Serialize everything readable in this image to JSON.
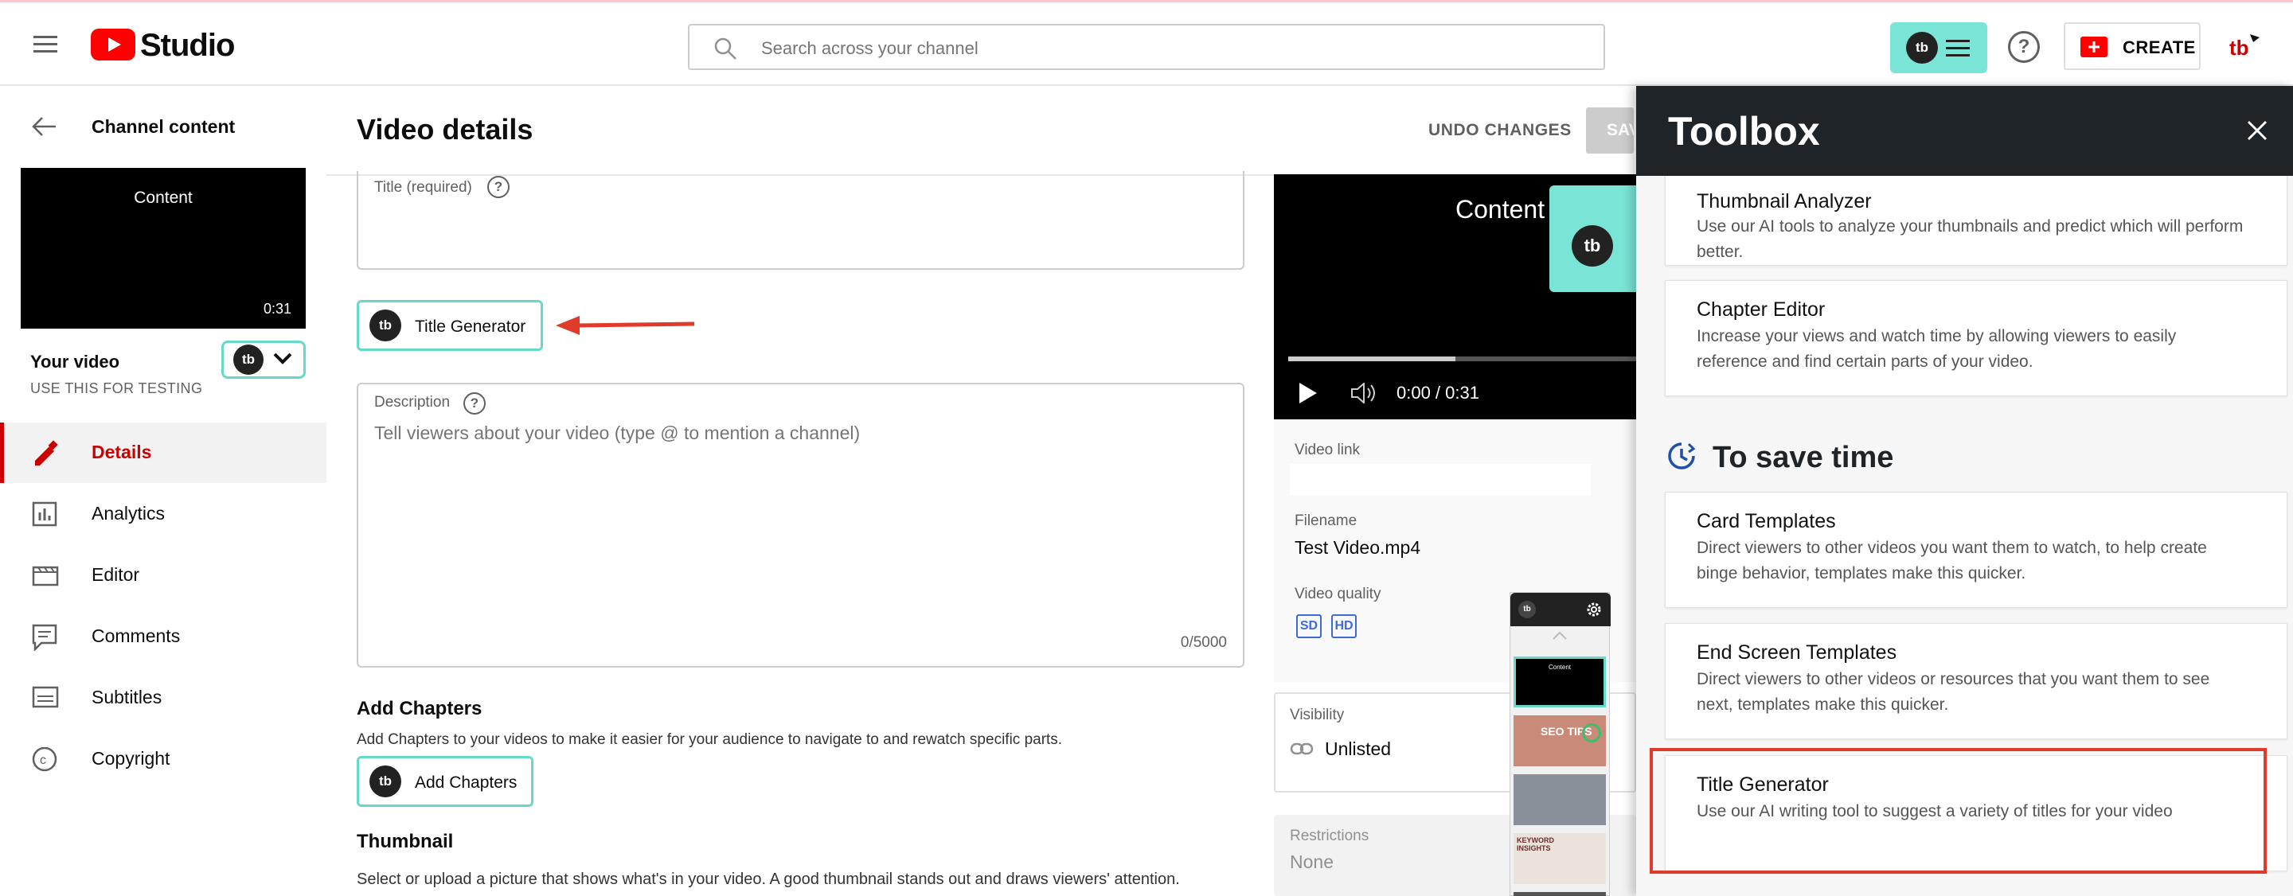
{
  "app": {
    "logo_text": "Studio"
  },
  "search": {
    "placeholder": "Search across your channel"
  },
  "header": {
    "create_label": "CREATE"
  },
  "sidebar": {
    "back_label": "Channel content",
    "preview_title": "Content",
    "preview_duration": "0:31",
    "video_title": "Your video",
    "video_subtitle": "USE THIS FOR TESTING",
    "items": [
      {
        "label": "Details",
        "icon": "pencil-icon",
        "active": true
      },
      {
        "label": "Analytics",
        "icon": "analytics-icon"
      },
      {
        "label": "Editor",
        "icon": "editor-icon"
      },
      {
        "label": "Comments",
        "icon": "comments-icon"
      },
      {
        "label": "Subtitles",
        "icon": "subtitles-icon"
      },
      {
        "label": "Copyright",
        "icon": "copyright-icon"
      }
    ]
  },
  "main": {
    "title": "Video details",
    "undo_label": "UNDO CHANGES",
    "save_label": "SAVE",
    "title_field_label": "Title (required)",
    "title_generator_label": "Title Generator",
    "description_label": "Description",
    "description_placeholder": "Tell viewers about your video (type @ to mention a channel)",
    "description_count": "0/5000",
    "chapters_heading": "Add Chapters",
    "chapters_desc": "Add Chapters to your videos to make it easier for your audience to navigate to and rewatch specific parts.",
    "add_chapters_label": "Add Chapters",
    "thumbnail_heading": "Thumbnail",
    "thumbnail_desc": "Select or upload a picture that shows what's in your video. A good thumbnail stands out and draws viewers' attention."
  },
  "video": {
    "overlay_text": "Content",
    "time": "0:00 / 0:31",
    "progress": 0.48,
    "link_label": "Video link",
    "filename_label": "Filename",
    "filename": "Test Video.mp4",
    "quality_label": "Video quality",
    "quality_badges": [
      "SD",
      "HD"
    ],
    "visibility_label": "Visibility",
    "visibility_value": "Unlisted",
    "restrictions_label": "Restrictions",
    "restrictions_value": "None"
  },
  "thumb_strip": {
    "first_label": "Content",
    "second_label": "SEO TIPS",
    "fourth_label": "KEYWORD INSIGHTS"
  },
  "toolbox": {
    "title": "Toolbox",
    "section_heading": "To save time",
    "cards": [
      {
        "title": "Thumbnail Analyzer",
        "desc": "Use our AI tools to analyze your thumbnails and predict which will perform better."
      },
      {
        "title": "Chapter Editor",
        "desc": "Increase your views and watch time by allowing viewers to easily reference and find certain parts of your video."
      },
      {
        "title": "Card Templates",
        "desc": "Direct viewers to other videos you want them to watch, to help create binge behavior, templates make this quicker."
      },
      {
        "title": "End Screen Templates",
        "desc": "Direct viewers to other videos or resources that you want them to see next, templates make this quicker."
      },
      {
        "title": "Title Generator",
        "desc": "Use our AI writing tool to suggest a variety of titles for your video"
      }
    ]
  },
  "colors": {
    "accent_red": "#cc0000",
    "tubebuddy_teal": "#7ae5d6",
    "highlight_red": "#e03a2a"
  }
}
